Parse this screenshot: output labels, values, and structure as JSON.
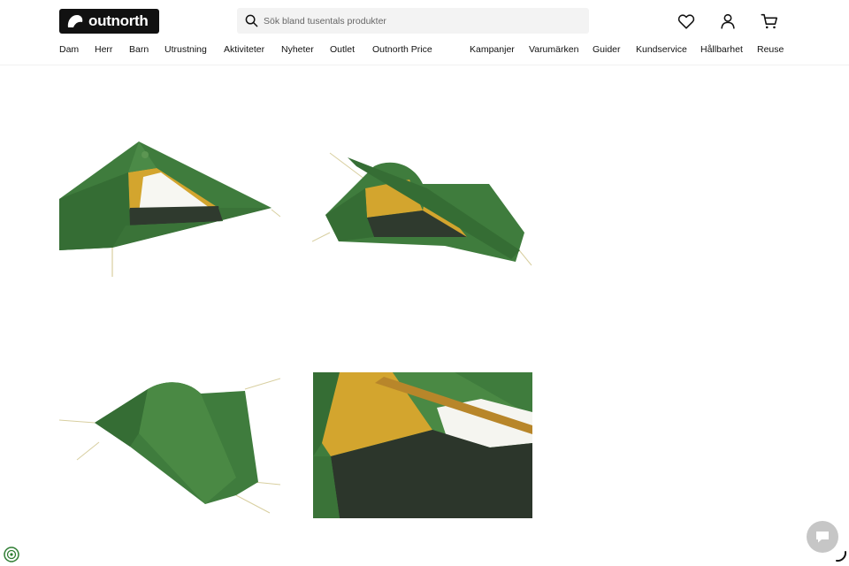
{
  "brand": {
    "logo_text": "outnorth"
  },
  "search": {
    "placeholder": "Sök bland tusentals produkter"
  },
  "nav_main": [
    "Dam",
    "Herr",
    "Barn",
    "Utrustning",
    "Aktiviteter",
    "Nyheter",
    "Outlet",
    "Outnorth Price"
  ],
  "nav_secondary": [
    "Kampanjer",
    "Varumärken",
    "Guider",
    "Kundservice",
    "Hållbarhet",
    "Reuse"
  ],
  "icons": {
    "wishlist": "heart-icon",
    "account": "user-icon",
    "cart": "cart-icon",
    "chat": "chat-icon",
    "eco": "eco-badge-icon"
  },
  "colors": {
    "tent_green": "#3e7a3c",
    "tent_yellow": "#d6a630",
    "logo_bg": "#111111",
    "chat_bg": "#c6c6c6"
  }
}
